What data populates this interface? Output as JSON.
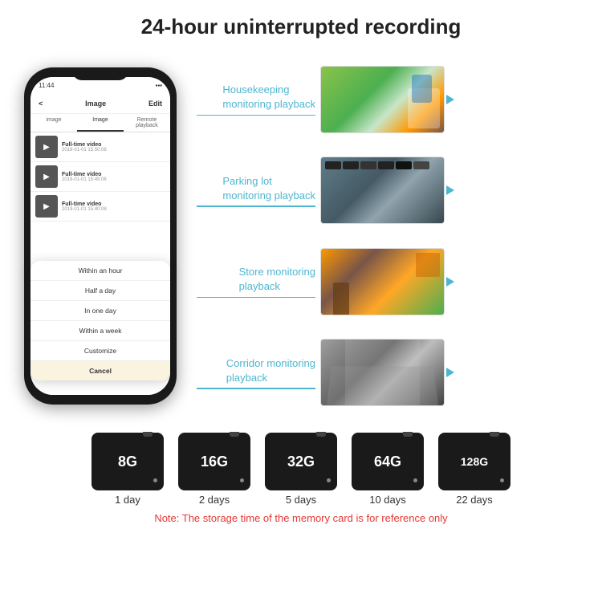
{
  "header": {
    "title": "24-hour uninterrupted recording"
  },
  "phone": {
    "status_time": "11:44",
    "nav_title": "Image",
    "nav_left": "<",
    "nav_right": "Edit",
    "tabs": [
      "image",
      "Image",
      "Remote playback"
    ],
    "video_items": [
      {
        "title": "Full-time video",
        "date": "2019-01-01 15:50:08"
      },
      {
        "title": "Full-time video",
        "date": "2019-01-01 15:45:06"
      },
      {
        "title": "Full-time video",
        "date": "2019-01-01 15:40:08"
      }
    ],
    "dropdown_items": [
      "Within an hour",
      "Half a day",
      "In one day",
      "Within a week",
      "Customize"
    ],
    "cancel_label": "Cancel"
  },
  "monitoring": {
    "labels": [
      "Housekeeping\nmonitoring playback",
      "Parking lot\nmonitoring playback",
      "Store monitoring\nplayback",
      "Corridor monitoring\nplayback"
    ]
  },
  "storage": {
    "cards": [
      {
        "size": "8G",
        "days": "1 day"
      },
      {
        "size": "16G",
        "days": "2 days"
      },
      {
        "size": "32G",
        "days": "5 days"
      },
      {
        "size": "64G",
        "days": "10 days"
      },
      {
        "size": "128G",
        "days": "22 days"
      }
    ],
    "note": "Note: The storage time of the memory card is for reference only"
  }
}
